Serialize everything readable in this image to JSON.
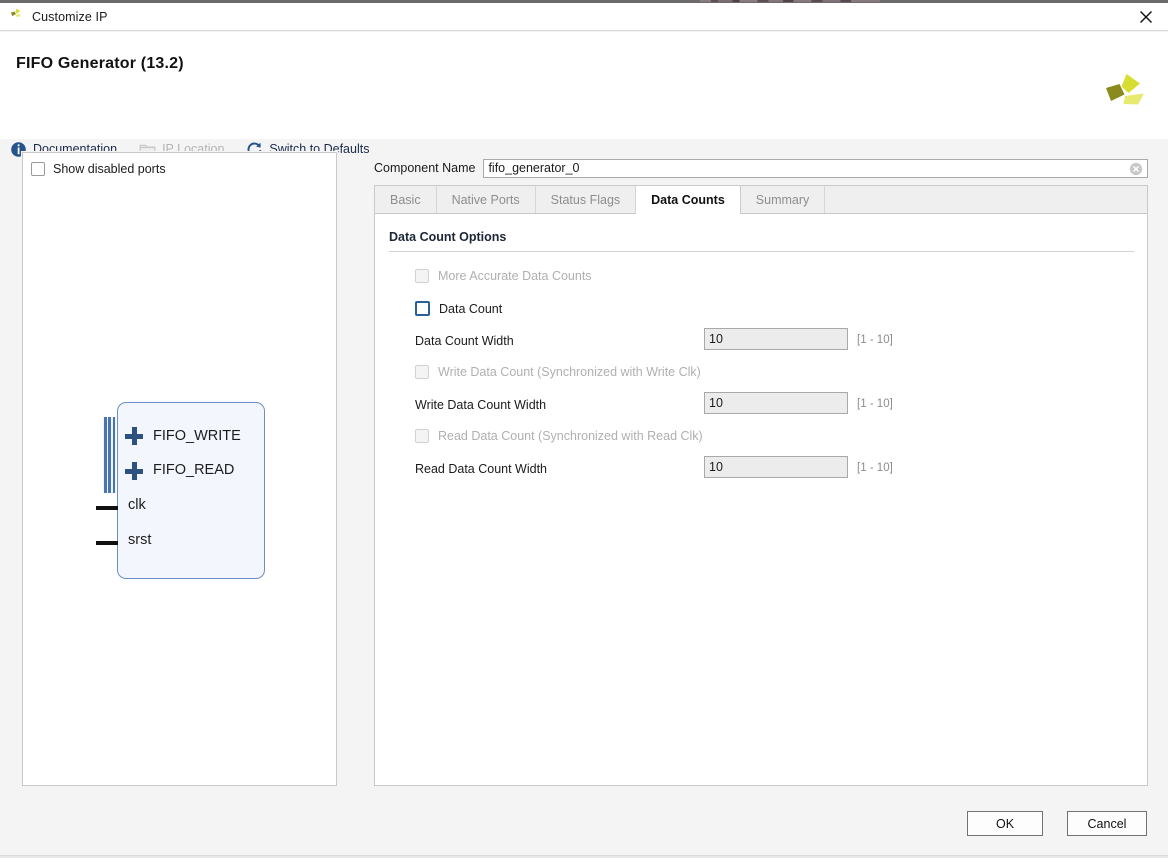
{
  "window": {
    "title": "Customize IP",
    "app_icon": "xilinx-logo-icon",
    "close_icon": "close-icon"
  },
  "header": {
    "title": "FIFO Generator (13.2)",
    "brand_icon": "xilinx-logo-icon"
  },
  "toolbar": {
    "items": [
      {
        "label": "Documentation",
        "icon": "info-icon",
        "enabled": true
      },
      {
        "label": "IP Location",
        "icon": "folder-icon",
        "enabled": false
      },
      {
        "label": "Switch to Defaults",
        "icon": "refresh-icon",
        "enabled": true
      }
    ]
  },
  "left_panel": {
    "show_disabled_ports": {
      "label": "Show disabled ports",
      "checked": false
    },
    "symbol": {
      "bus_ports": [
        {
          "name": "FIFO_WRITE",
          "expander": "plus-icon"
        },
        {
          "name": "FIFO_READ",
          "expander": "plus-icon"
        }
      ],
      "scalar_ports": [
        {
          "name": "clk"
        },
        {
          "name": "srst"
        }
      ]
    }
  },
  "component_name": {
    "label": "Component Name",
    "value": "fifo_generator_0",
    "placeholder": "fifo_generator_0",
    "clear_icon": "clear-icon"
  },
  "tabs": [
    {
      "label": "Basic",
      "active": false
    },
    {
      "label": "Native Ports",
      "active": false
    },
    {
      "label": "Status Flags",
      "active": false
    },
    {
      "label": "Data Counts",
      "active": true
    },
    {
      "label": "Summary",
      "active": false
    }
  ],
  "data_counts": {
    "section_title": "Data Count Options",
    "rows": [
      {
        "kind": "checkbox",
        "label": "More Accurate Data Counts",
        "checked": false,
        "enabled": false
      },
      {
        "kind": "checkbox",
        "label": "Data Count",
        "checked": false,
        "enabled": true
      },
      {
        "kind": "field",
        "label": "Data Count Width",
        "value": "10",
        "range": "[1 - 10]",
        "enabled": false
      },
      {
        "kind": "checkbox",
        "label": "Write Data Count (Synchronized with Write Clk)",
        "checked": false,
        "enabled": false
      },
      {
        "kind": "field",
        "label": "Write Data Count Width",
        "value": "10",
        "range": "[1 - 10]",
        "enabled": false
      },
      {
        "kind": "checkbox",
        "label": "Read Data Count (Synchronized with Read Clk)",
        "checked": false,
        "enabled": false
      },
      {
        "kind": "field",
        "label": "Read Data Count Width",
        "value": "10",
        "range": "[1 - 10]",
        "enabled": false
      }
    ]
  },
  "footer": {
    "ok_label": "OK",
    "cancel_label": "Cancel"
  },
  "colors": {
    "accent_blue": "#2a6099",
    "link_navy": "#1b2a4a",
    "brand_yellow": "#d8dd33",
    "brand_olive": "#8a8a1e",
    "symbol_fill": "#f3f7fd",
    "symbol_border": "#6b8fc4",
    "disabled_text": "#b0b0b0",
    "field_disabled_bg": "#ececec"
  }
}
